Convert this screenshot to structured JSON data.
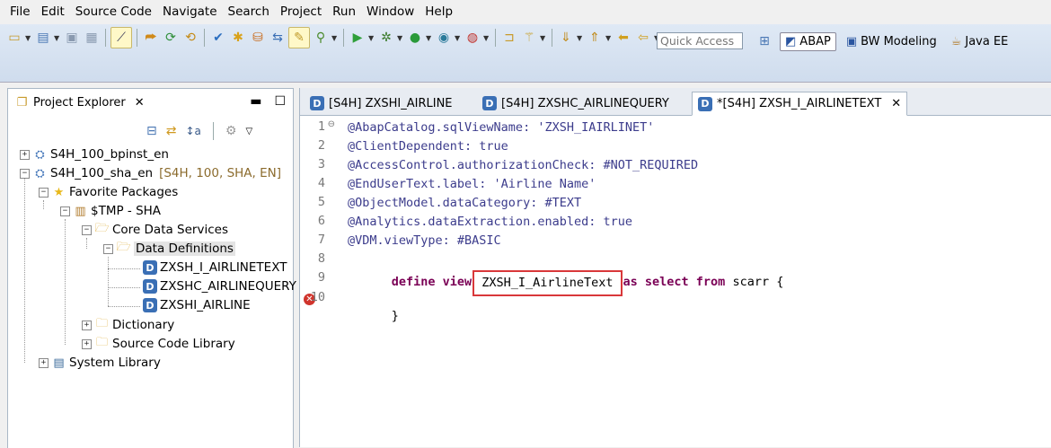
{
  "menu": [
    "File",
    "Edit",
    "Source Code",
    "Navigate",
    "Search",
    "Project",
    "Run",
    "Window",
    "Help"
  ],
  "toolbar": {
    "quick_access_placeholder": "Quick Access"
  },
  "perspectives": [
    {
      "label": "ABAP",
      "active": true
    },
    {
      "label": "BW Modeling",
      "active": false
    },
    {
      "label": "Java EE",
      "active": false
    }
  ],
  "explorer": {
    "title": "Project Explorer",
    "tree": [
      {
        "label": "S4H_100_bpinst_en",
        "decor": ""
      },
      {
        "label": "S4H_100_sha_en",
        "decor": "[S4H, 100, SHA, EN]"
      },
      {
        "label": "Favorite Packages",
        "decor": ""
      },
      {
        "label": "$TMP - SHA",
        "decor": ""
      },
      {
        "label": "Core Data Services",
        "decor": ""
      },
      {
        "label": "Data Definitions",
        "decor": ""
      },
      {
        "label": "ZXSH_I_AIRLINETEXT",
        "decor": ""
      },
      {
        "label": "ZXSHC_AIRLINEQUERY",
        "decor": ""
      },
      {
        "label": "ZXSHI_AIRLINE",
        "decor": ""
      },
      {
        "label": "Dictionary",
        "decor": ""
      },
      {
        "label": "Source Code Library",
        "decor": ""
      },
      {
        "label": "System Library",
        "decor": ""
      }
    ]
  },
  "editor": {
    "tabs": [
      {
        "label": "[S4H] ZXSHI_AIRLINE",
        "active": false
      },
      {
        "label": "[S4H] ZXSHC_AIRLINEQUERY",
        "active": false
      },
      {
        "label": "*[S4H] ZXSH_I_AIRLINETEXT",
        "active": true
      }
    ],
    "line_numbers": [
      "1",
      "2",
      "3",
      "4",
      "5",
      "6",
      "7",
      "8",
      "9",
      "10"
    ],
    "lines": [
      "@AbapCatalog.sqlViewName: 'ZXSH_IAIRLINET'",
      "@ClientDependent: true",
      "@AccessControl.authorizationCheck: #NOT_REQUIRED",
      "@EndUserText.label: 'Airline Name'",
      "@ObjectModel.dataCategory: #TEXT",
      "@Analytics.dataExtraction.enabled: true",
      "@VDM.viewType: #BASIC"
    ],
    "line8": {
      "kw1": "define view",
      "view_name": "ZXSH_I_AirlineText",
      "kw2": "as select from",
      "source": "scarr",
      "brace": "{"
    },
    "line10": "}"
  },
  "colors": {
    "annotation": "#3c3c8c",
    "keyword": "#7a0055",
    "highlight_box": "#d9383a"
  }
}
